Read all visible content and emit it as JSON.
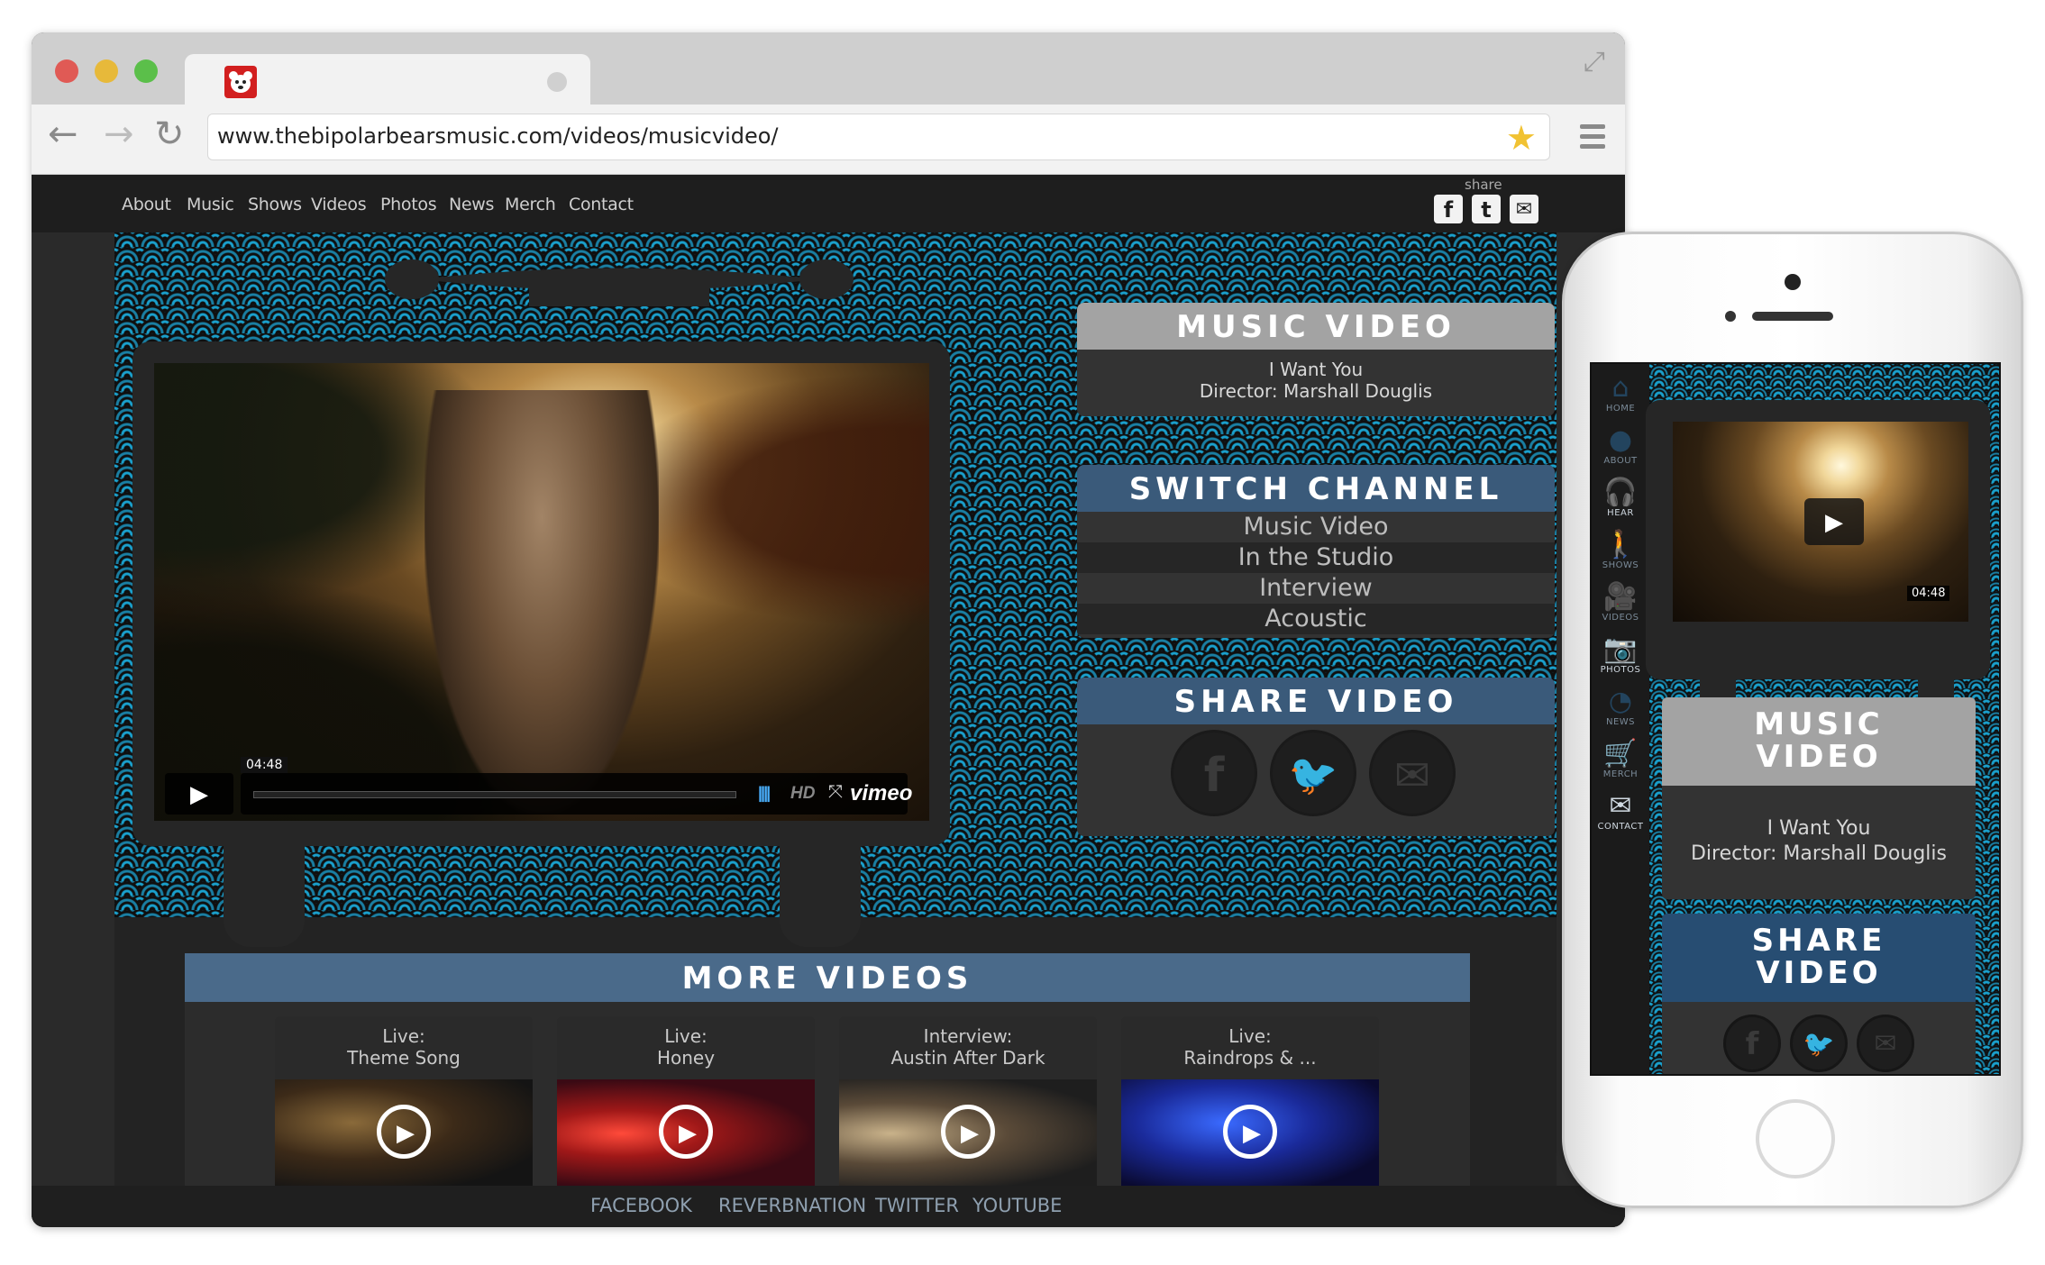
{
  "browser": {
    "url": "www.thebipolarbearsmusic.com/videos/musicvideo/",
    "traffic_lights": {
      "close": "#e05a55",
      "minimize": "#e7b93a",
      "maximize": "#5bbf4a"
    },
    "icons": {
      "back": "back-arrow-icon",
      "forward": "forward-arrow-icon",
      "reload": "reload-icon",
      "bookmark": "star-icon",
      "menu": "hamburger-menu-icon",
      "fullscreen": "fullscreen-icon"
    }
  },
  "site": {
    "nav": [
      "About",
      "Music",
      "Shows",
      "Videos",
      "Photos",
      "News",
      "Merch",
      "Contact"
    ],
    "share_label": "share",
    "share_icons": {
      "facebook": "f",
      "twitter": "t",
      "email": "✉"
    },
    "player": {
      "time": "04:48",
      "hd": "HD",
      "brand": "vimeo"
    },
    "music_video_panel": {
      "title": "MUSIC VIDEO",
      "song": "I Want You",
      "director": "Director: Marshall Douglis"
    },
    "switch_channel_panel": {
      "title": "SWITCH CHANNEL",
      "channels": [
        "Music Video",
        "In the Studio",
        "Interview",
        "Acoustic"
      ]
    },
    "share_video_panel": {
      "title": "SHARE VIDEO",
      "icons": {
        "facebook": "f",
        "twitter": "🐦",
        "email": "✉"
      }
    },
    "more_videos": {
      "title": "MORE VIDEOS",
      "items": [
        {
          "line1": "Live:",
          "line2": "Theme Song"
        },
        {
          "line1": "Live:",
          "line2": "Honey"
        },
        {
          "line1": "Interview:",
          "line2": "Austin After Dark"
        },
        {
          "line1": "Live:",
          "line2": "Raindrops & ..."
        }
      ]
    },
    "footer": [
      "FACEBOOK",
      "REVERBNATION",
      "TWITTER",
      "YOUTUBE"
    ],
    "colors": {
      "accent_blue": "#3a5a7a",
      "panel_gray": "#a3a3a3",
      "pattern_blue": "#1aa0cc"
    }
  },
  "phone": {
    "sidebar": [
      "HOME",
      "ABOUT",
      "HEAR",
      "SHOWS",
      "VIDEOS",
      "PHOTOS",
      "NEWS",
      "MERCH",
      "CONTACT"
    ],
    "time": "04:48",
    "music_video": {
      "title_line1": "MUSIC",
      "title_line2": "VIDEO",
      "song": "I Want You",
      "director": "Director: Marshall Douglis"
    },
    "share_video": {
      "title_line1": "SHARE",
      "title_line2": "VIDEO"
    }
  }
}
